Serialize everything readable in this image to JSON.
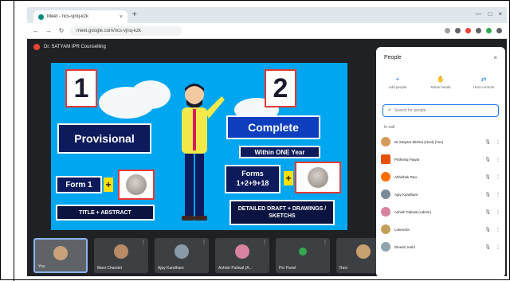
{
  "browser": {
    "tab_title": "Meet - ncs-vjnq-kzk",
    "tab_close": "×",
    "newtab": "+",
    "url": "meet.google.com/ncs-vjnq-kzk",
    "window_controls": [
      "—",
      "□",
      "×"
    ]
  },
  "meeting": {
    "title": "Dr. SATYAM IPR Counselling"
  },
  "slide": {
    "num1": "1",
    "num2": "2",
    "provisional": "Provisional",
    "complete": "Complete",
    "within": "Within ONE Year",
    "form1": "Form 1",
    "forms": "Forms 1+2+9+18",
    "plus": "+",
    "title_abstract": "TITLE + ABSTRACT",
    "detailed": "DETAILED DRAFT + DRAWINGS / SKETCHS"
  },
  "tiles": [
    {
      "name": "You",
      "color": "#c9a27a",
      "active": true
    },
    {
      "name": "Mani Chandel",
      "color": "#b98a66"
    },
    {
      "name": "Ajay Kandhare",
      "color": "#8a9aa6"
    },
    {
      "name": "Ashish Paliwal (A...",
      "color": "#d783a0"
    },
    {
      "name": "Pin Panel",
      "color": "#34a853"
    },
    {
      "name": "Ravi",
      "color": "#c8a070"
    }
  ],
  "panel": {
    "title": "People",
    "close": "×",
    "actions": [
      {
        "icon": "+",
        "label": "Add people"
      },
      {
        "icon": "✋",
        "label": "Raise hands"
      },
      {
        "icon": "⇄",
        "label": "Host controls"
      }
    ],
    "search_placeholder": "Search for people",
    "section": "In call",
    "participants": [
      {
        "name": "Dr Satyam Mishra (Host) (You)",
        "color": "#d49a5a"
      },
      {
        "name": "Prithviraj Pawar",
        "color": "#e65100"
      },
      {
        "name": "Abhishek Rao",
        "color": "#ff6d00"
      },
      {
        "name": "Ajay Kandhare",
        "color": "#7b8a96"
      },
      {
        "name": "Ashish Paliwal (Admin)",
        "color": "#d783a0"
      },
      {
        "name": "Lokendra",
        "color": "#c2a05a"
      },
      {
        "name": "Dinesh Joshi",
        "color": "#90a4ae"
      }
    ]
  }
}
